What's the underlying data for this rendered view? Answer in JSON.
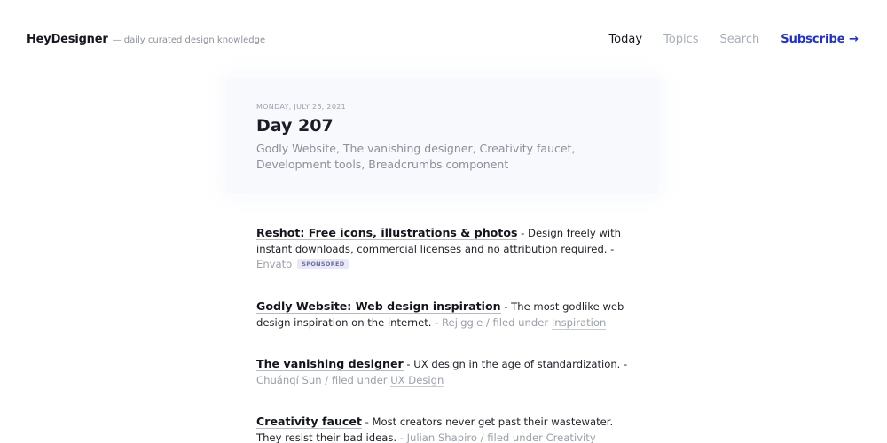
{
  "header": {
    "brand_name": "HeyDesigner",
    "brand_tagline": "— daily curated design knowledge",
    "nav": {
      "today": "Today",
      "topics": "Topics",
      "search": "Search",
      "subscribe": "Subscribe →"
    }
  },
  "day": {
    "date": "MONDAY, JULY 26, 2021",
    "title": "Day 207",
    "summary": "Godly Website, The vanishing designer, Creativity faucet, Development tools, Breadcrumbs component"
  },
  "feed": {
    "sponsored": {
      "title": "Reshot: Free icons, illustrations & photos",
      "desc": " - Design freely with instant downloads, commercial licenses and no attribution required. -",
      "source": "Envato",
      "badge": "SPONSORED"
    },
    "items": [
      {
        "title": "Godly Website: Web design inspiration",
        "desc": " - The most godlike web design inspiration on the internet.",
        "meta": " - Rejiggle / filed under ",
        "category": "Inspiration"
      },
      {
        "title": "The vanishing designer",
        "desc": " - UX design in the age of standardization. -",
        "meta": "Chuánqí Sun / filed under ",
        "category": "UX Design"
      },
      {
        "title": "Creativity faucet",
        "desc": " - Most creators never get past their wastewater. They resist their bad ideas.",
        "meta": " - Julian Shapiro / filed under ",
        "category": "Creativity"
      }
    ]
  }
}
